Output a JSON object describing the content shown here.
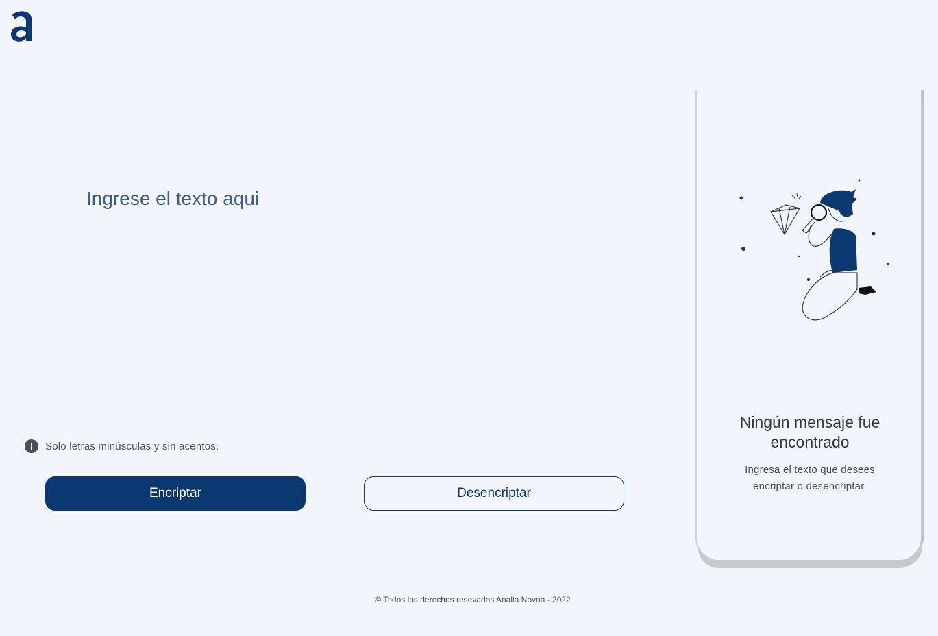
{
  "header": {
    "logo_icon": "alura-a-logo-icon"
  },
  "input": {
    "placeholder": "Ingrese el texto aqui",
    "value": ""
  },
  "hint": {
    "icon": "exclamation-circle-icon",
    "text": "Solo letras minúsculas y sin acentos."
  },
  "actions": {
    "encrypt_label": "Encriptar",
    "decrypt_label": "Desencriptar"
  },
  "result": {
    "illustration": "person-magnifying-glass-diamond-illustration",
    "title": "Ningún mensaje fue encontrado",
    "subtitle": "Ingresa el texto que desees encriptar o desencriptar."
  },
  "footer": {
    "text": "© Todos los derechos resevados Analia Novoa - 2022"
  },
  "colors": {
    "primary": "#0a3871",
    "background": "#f3f5fc",
    "text_gray": "#495057"
  }
}
